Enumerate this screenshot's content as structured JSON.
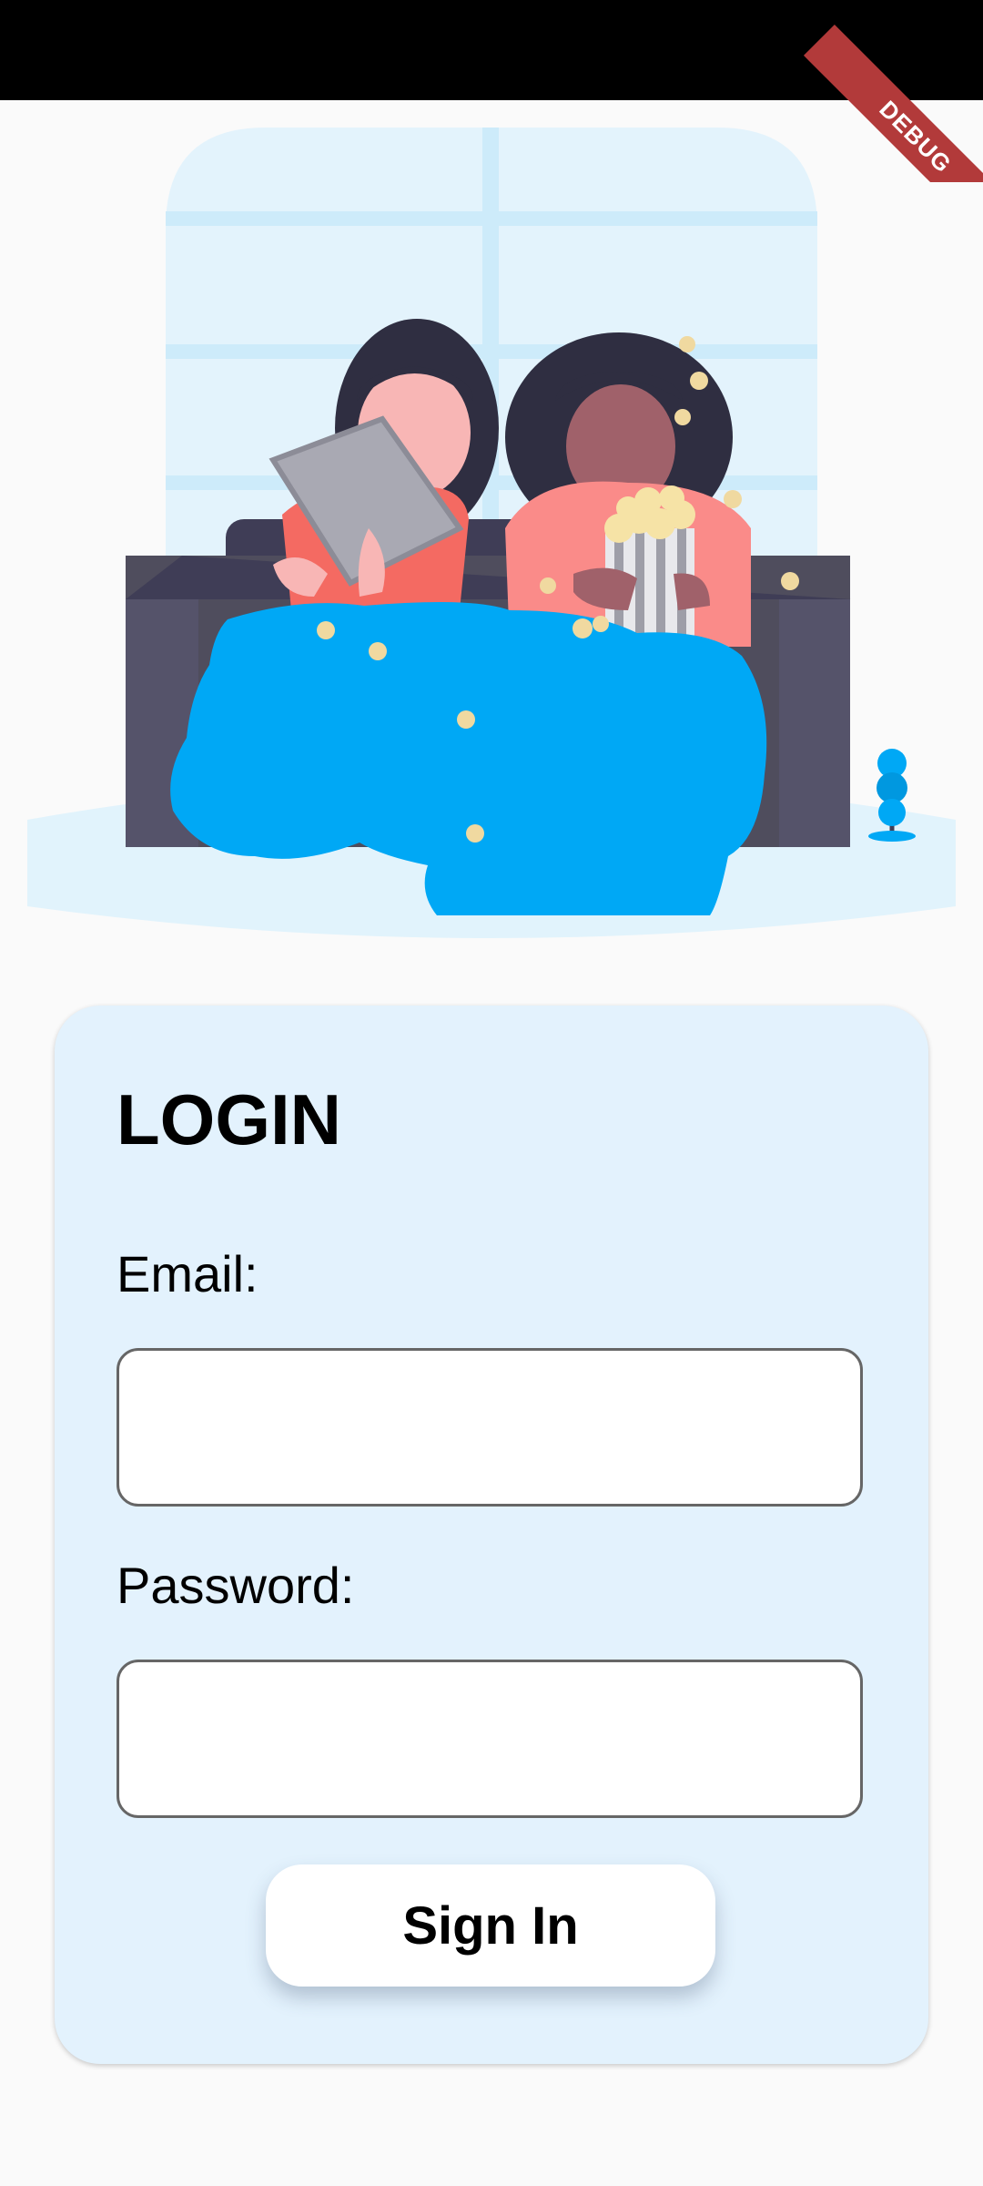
{
  "debug_banner": {
    "label": "DEBUG"
  },
  "login_card": {
    "title": "LOGIN",
    "email": {
      "label": "Email:",
      "value": "",
      "placeholder": ""
    },
    "password": {
      "label": "Password:",
      "value": "",
      "placeholder": ""
    },
    "sign_in_label": "Sign In"
  },
  "colors": {
    "card_background": "#e3f2fd",
    "blanket_blue": "#00a8f5",
    "sofa_dark": "#4f4d5d",
    "debug_red": "#b23a3a"
  }
}
